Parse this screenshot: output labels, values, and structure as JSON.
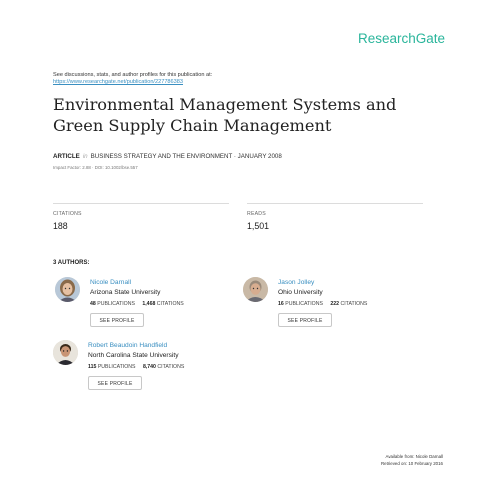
{
  "header": {
    "brand": "ResearchGate",
    "discuss_text": "See discussions, stats, and author profiles for this publication at:",
    "url": "https://www.researchgate.net/publication/227786383"
  },
  "article": {
    "title_line1": "Environmental Management Systems and",
    "title_line2": "Green Supply Chain Management",
    "type": "ARTICLE",
    "in_word": "in",
    "journal_date": "BUSINESS STRATEGY AND THE ENVIRONMENT · JANUARY 2008",
    "impact": "Impact Factor: 2.88 · DOI: 10.1002/bse.557"
  },
  "stats": {
    "citations_label": "CITATIONS",
    "citations_value": "188",
    "reads_label": "READS",
    "reads_value": "1,501"
  },
  "authors_heading": "3 AUTHORS:",
  "authors": [
    {
      "name": "Nicole Darnall",
      "institution": "Arizona State University",
      "publications": "48",
      "publications_label": "PUBLICATIONS",
      "citations": "1,468",
      "citations_label": "CITATIONS",
      "button": "SEE PROFILE"
    },
    {
      "name": "Jason Jolley",
      "institution": "Ohio University",
      "publications": "16",
      "publications_label": "PUBLICATIONS",
      "citations": "222",
      "citations_label": "CITATIONS",
      "button": "SEE PROFILE"
    },
    {
      "name": "Robert Beaudoin Handfield",
      "institution": "North Carolina State University",
      "publications": "115",
      "publications_label": "PUBLICATIONS",
      "citations": "8,740",
      "citations_label": "CITATIONS",
      "button": "SEE PROFILE"
    }
  ],
  "footer": {
    "available": "Available from: Nicole Darnall",
    "retrieved": "Retrieved on: 10 February 2016"
  },
  "colors": {
    "brand": "#2ab59b",
    "link": "#3a8fc1"
  }
}
